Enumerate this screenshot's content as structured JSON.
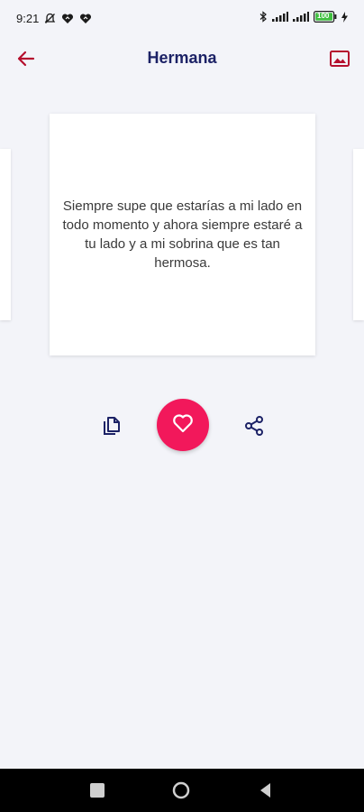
{
  "status_bar": {
    "time": "9:21",
    "battery_level": "100",
    "icons": [
      "notification-muted-icon",
      "heart-icon",
      "heart-icon",
      "bluetooth-icon",
      "signal-icon",
      "signal-icon",
      "battery-icon",
      "charging-icon"
    ]
  },
  "app_bar": {
    "title": "Hermana",
    "back_icon": "arrow-left-icon",
    "image_icon": "image-icon"
  },
  "quote": {
    "text": "Siempre supe que estarías a mi lado en todo momento y ahora siempre estaré a tu lado y a mi sobrina que es tan hermosa."
  },
  "actions": {
    "copy_icon": "copy-icon",
    "favorite_icon": "heart-outline-icon",
    "share_icon": "share-icon"
  },
  "colors": {
    "background": "#f3f4f9",
    "title": "#1c2266",
    "accent_red": "#b5102e",
    "favorite_button": "#f2185b",
    "icon_navy": "#1c2266"
  },
  "nav_bar": {
    "icons": [
      "recents-icon",
      "home-icon",
      "back-icon"
    ]
  }
}
